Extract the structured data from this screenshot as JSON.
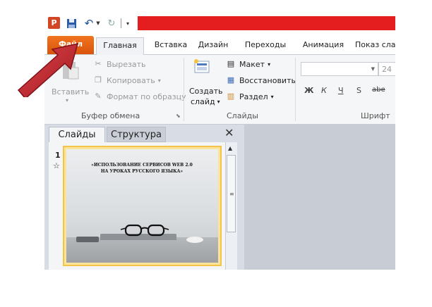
{
  "qat": {
    "logo": "P",
    "icons": [
      "save-icon",
      "undo-icon",
      "redo-icon",
      "customize-icon"
    ]
  },
  "tabs": [
    "Файл",
    "Главная",
    "Вставка",
    "Дизайн",
    "Переходы",
    "Анимация",
    "Показ сла"
  ],
  "clipboard": {
    "paste": "Вставить",
    "cut": "Вырезать",
    "copy": "Копировать",
    "format": "Формат по образцу",
    "label": "Буфер обмена"
  },
  "slides_group": {
    "new_slide_1": "Создать",
    "new_slide_2": "слайд",
    "layout": "Макет",
    "reset": "Восстановить",
    "section": "Раздел",
    "label": "Слайды"
  },
  "font": {
    "size": "24",
    "label": "Шрифт",
    "bold": "Ж",
    "italic": "К",
    "underline": "Ч",
    "shadow": "S",
    "strike": "abe"
  },
  "panel": {
    "tab_slides": "Слайды",
    "tab_outline": "Структура",
    "close": "✕"
  },
  "slide": {
    "number": "1",
    "title_line1": "«ИСПОЛЬЗОВАНИЕ СЕРВИСОВ WEB 2.0",
    "title_line2": "НА УРОКАХ РУССКОГО ЯЗЫКА»"
  },
  "colors": {
    "file_tab": "#e2661a",
    "accent_red": "#e41e1e",
    "arrow": "#c0272d"
  }
}
